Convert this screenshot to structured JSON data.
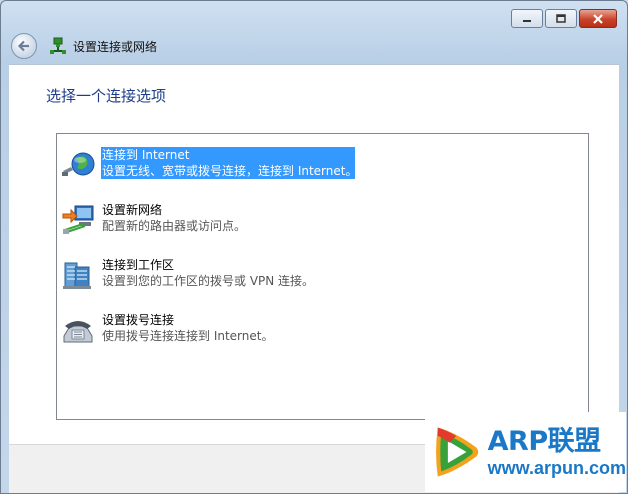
{
  "window": {
    "title": "设置连接或网络",
    "controls": [
      "minimize-icon",
      "maximize-icon",
      "close-icon"
    ]
  },
  "page": {
    "heading": "选择一个连接选项"
  },
  "options": [
    {
      "title": "连接到 Internet",
      "description": "设置无线、宽带或拨号连接，连接到 Internet。",
      "icon": "globe-icon",
      "selected": true
    },
    {
      "title": "设置新网络",
      "description": "配置新的路由器或访问点。",
      "icon": "network-setup-icon",
      "selected": false
    },
    {
      "title": "连接到工作区",
      "description": "设置到您的工作区的拨号或 VPN 连接。",
      "icon": "workplace-icon",
      "selected": false
    },
    {
      "title": "设置拨号连接",
      "description": "使用拨号连接连接到 Internet。",
      "icon": "dialup-phone-icon",
      "selected": false
    }
  ],
  "watermark": {
    "brand": "ARP联盟",
    "url": "www.arpun.com"
  },
  "colors": {
    "selection": "#3399ff",
    "heading": "#1e3d8a",
    "brand": "#1a78c7"
  }
}
